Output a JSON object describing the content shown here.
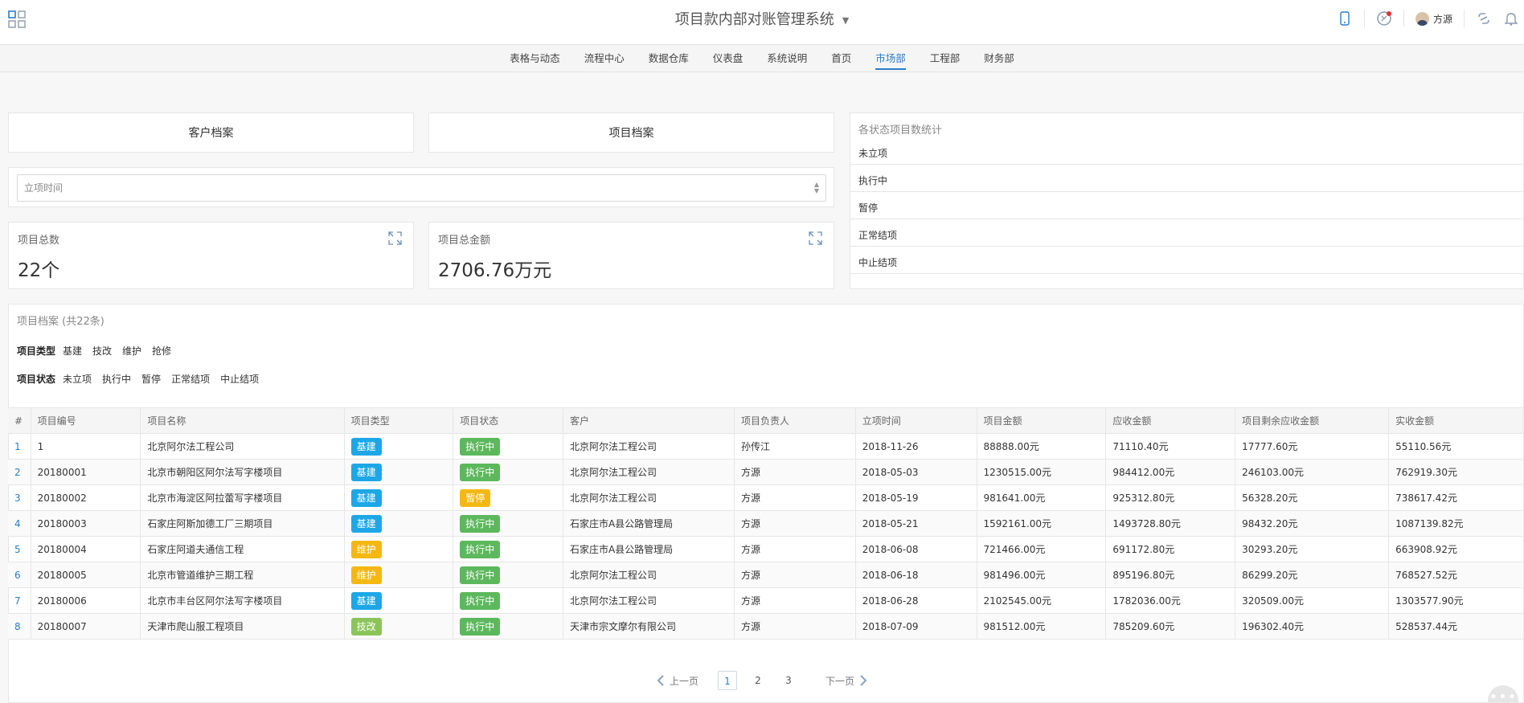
{
  "header": {
    "title": "项目款内部对账管理系统",
    "user_name": "方源",
    "icons": [
      "grid-icon",
      "phone-icon",
      "notification-dot-icon",
      "avatar",
      "link-icon",
      "bell-icon"
    ]
  },
  "nav": {
    "items": [
      "表格与动态",
      "流程中心",
      "数据仓库",
      "仪表盘",
      "系统说明",
      "首页",
      "市场部",
      "工程部",
      "财务部"
    ],
    "active": "市场部"
  },
  "buttons": {
    "customer": "客户档案",
    "project": "项目档案"
  },
  "filter": {
    "placeholder": "立项时间"
  },
  "stats": {
    "count_label": "项目总数",
    "count_value": "22个",
    "amount_label": "项目总金额",
    "amount_value": "2706.76万元"
  },
  "status_stats": {
    "title": "各状态项目数统计",
    "rows": [
      "未立项",
      "执行中",
      "暂停",
      "正常结项",
      "中止结项"
    ]
  },
  "project_list": {
    "title": "项目档案 (共22条)",
    "type_label": "项目类型",
    "types": [
      "基建",
      "技改",
      "维护",
      "抢修"
    ],
    "status_label": "项目状态",
    "statuses": [
      "未立项",
      "执行中",
      "暂停",
      "正常结项",
      "中止结项"
    ],
    "columns": [
      "#",
      "项目编号",
      "项目名称",
      "项目类型",
      "项目状态",
      "客户",
      "项目负责人",
      "立项时间",
      "项目金额",
      "应收金额",
      "项目剩余应收金额",
      "实收金额"
    ],
    "type_colors": {
      "基建": "#1ea7e6",
      "维护": "#f5b812",
      "技改": "#8bc55a"
    },
    "status_colors": {
      "执行中": "#5cb85c",
      "暂停": "#f5b812"
    },
    "rows": [
      [
        "1",
        "1",
        "北京阿尔法工程公司",
        "基建",
        "执行中",
        "北京阿尔法工程公司",
        "孙传江",
        "2018-11-26",
        "88888.00元",
        "71110.40元",
        "17777.60元",
        "55110.56元"
      ],
      [
        "2",
        "20180001",
        "北京市朝阳区阿尔法写字楼项目",
        "基建",
        "执行中",
        "北京阿尔法工程公司",
        "方源",
        "2018-05-03",
        "1230515.00元",
        "984412.00元",
        "246103.00元",
        "762919.30元"
      ],
      [
        "3",
        "20180002",
        "北京市海淀区阿拉蕾写字楼项目",
        "基建",
        "暂停",
        "北京阿尔法工程公司",
        "方源",
        "2018-05-19",
        "981641.00元",
        "925312.80元",
        "56328.20元",
        "738617.42元"
      ],
      [
        "4",
        "20180003",
        "石家庄阿斯加德工厂三期项目",
        "基建",
        "执行中",
        "石家庄市A县公路管理局",
        "方源",
        "2018-05-21",
        "1592161.00元",
        "1493728.80元",
        "98432.20元",
        "1087139.82元"
      ],
      [
        "5",
        "20180004",
        "石家庄阿道夫通信工程",
        "维护",
        "执行中",
        "石家庄市A县公路管理局",
        "方源",
        "2018-06-08",
        "721466.00元",
        "691172.80元",
        "30293.20元",
        "663908.92元"
      ],
      [
        "6",
        "20180005",
        "北京市管道维护三期工程",
        "维护",
        "执行中",
        "北京阿尔法工程公司",
        "方源",
        "2018-06-18",
        "981496.00元",
        "895196.80元",
        "86299.20元",
        "768527.52元"
      ],
      [
        "7",
        "20180006",
        "北京市丰台区阿尔法写字楼项目",
        "基建",
        "执行中",
        "北京阿尔法工程公司",
        "方源",
        "2018-06-28",
        "2102545.00元",
        "1782036.00元",
        "320509.00元",
        "1303577.90元"
      ],
      [
        "8",
        "20180007",
        "天津市爬山服工程项目",
        "技改",
        "执行中",
        "天津市宗文摩尔有限公司",
        "方源",
        "2018-07-09",
        "981512.00元",
        "785209.60元",
        "196302.40元",
        "528537.44元"
      ]
    ]
  },
  "pagination": {
    "prev": "上一页",
    "next": "下一页",
    "pages": [
      "1",
      "2",
      "3"
    ],
    "current": "1"
  }
}
